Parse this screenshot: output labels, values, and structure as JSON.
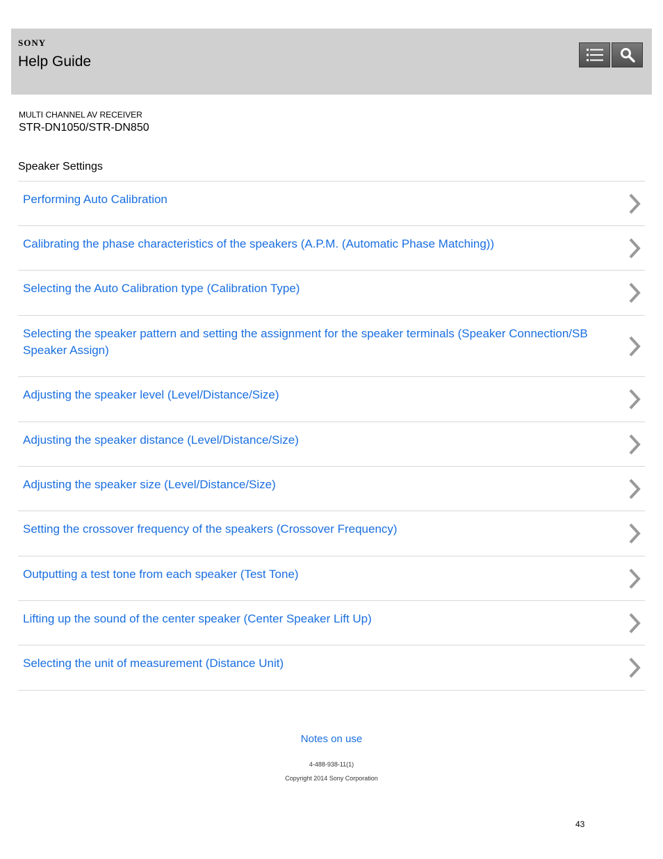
{
  "header": {
    "brand": "SONY",
    "title": "Help Guide"
  },
  "product": {
    "line": "MULTI CHANNEL AV RECEIVER",
    "model": "STR-DN1050/STR-DN850"
  },
  "section_title": "Speaker Settings",
  "items": [
    {
      "label": "Performing Auto Calibration"
    },
    {
      "label": "Calibrating the phase characteristics of the speakers (A.P.M. (Automatic Phase Matching))"
    },
    {
      "label": "Selecting the Auto Calibration type (Calibration Type)"
    },
    {
      "label": "Selecting the speaker pattern and setting the assignment for the speaker terminals (Speaker Connection/SB Speaker Assign)"
    },
    {
      "label": "Adjusting the speaker level (Level/Distance/Size)"
    },
    {
      "label": "Adjusting the speaker distance (Level/Distance/Size)"
    },
    {
      "label": "Adjusting the speaker size (Level/Distance/Size)"
    },
    {
      "label": "Setting the crossover frequency of the speakers (Crossover Frequency)"
    },
    {
      "label": "Outputting a test tone from each speaker (Test Tone)"
    },
    {
      "label": "Lifting up the sound of the center speaker (Center Speaker Lift Up)"
    },
    {
      "label": "Selecting the unit of measurement (Distance Unit)"
    }
  ],
  "footer": {
    "notes": "Notes on use",
    "doc_number": "4-488-938-11(1)",
    "copyright": "Copyright 2014 Sony Corporation"
  },
  "page_number": "43",
  "colors": {
    "link": "#1a6fe0",
    "header_bg": "#d0d0d0",
    "chevron": "#999999"
  }
}
